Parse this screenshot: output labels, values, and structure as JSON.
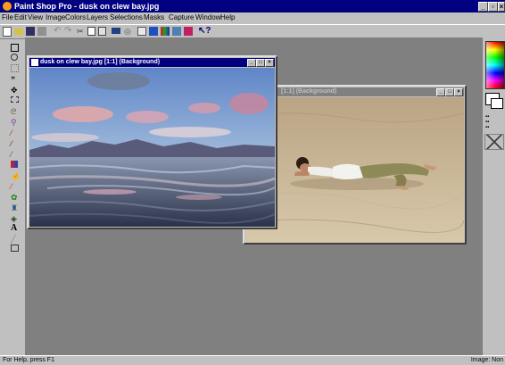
{
  "window": {
    "title": "Paint Shop Pro - dusk on clew bay.jpg"
  },
  "menu": [
    "File",
    "Edit",
    "View",
    "Image",
    "Colors",
    "Layers",
    "Selections",
    "Masks",
    "Capture",
    "Window",
    "Help"
  ],
  "images": [
    {
      "title": "dusk on clew bay.jpg [1:1] (Background)"
    },
    {
      "title": "[1:1] (Background)"
    }
  ],
  "status": {
    "left": "For Help, press F1",
    "right": "Image: Non"
  },
  "colors": {
    "title_active": "#000080",
    "title_inactive": "#808080",
    "workspace": "#808080",
    "chrome": "#c0c0c0"
  }
}
